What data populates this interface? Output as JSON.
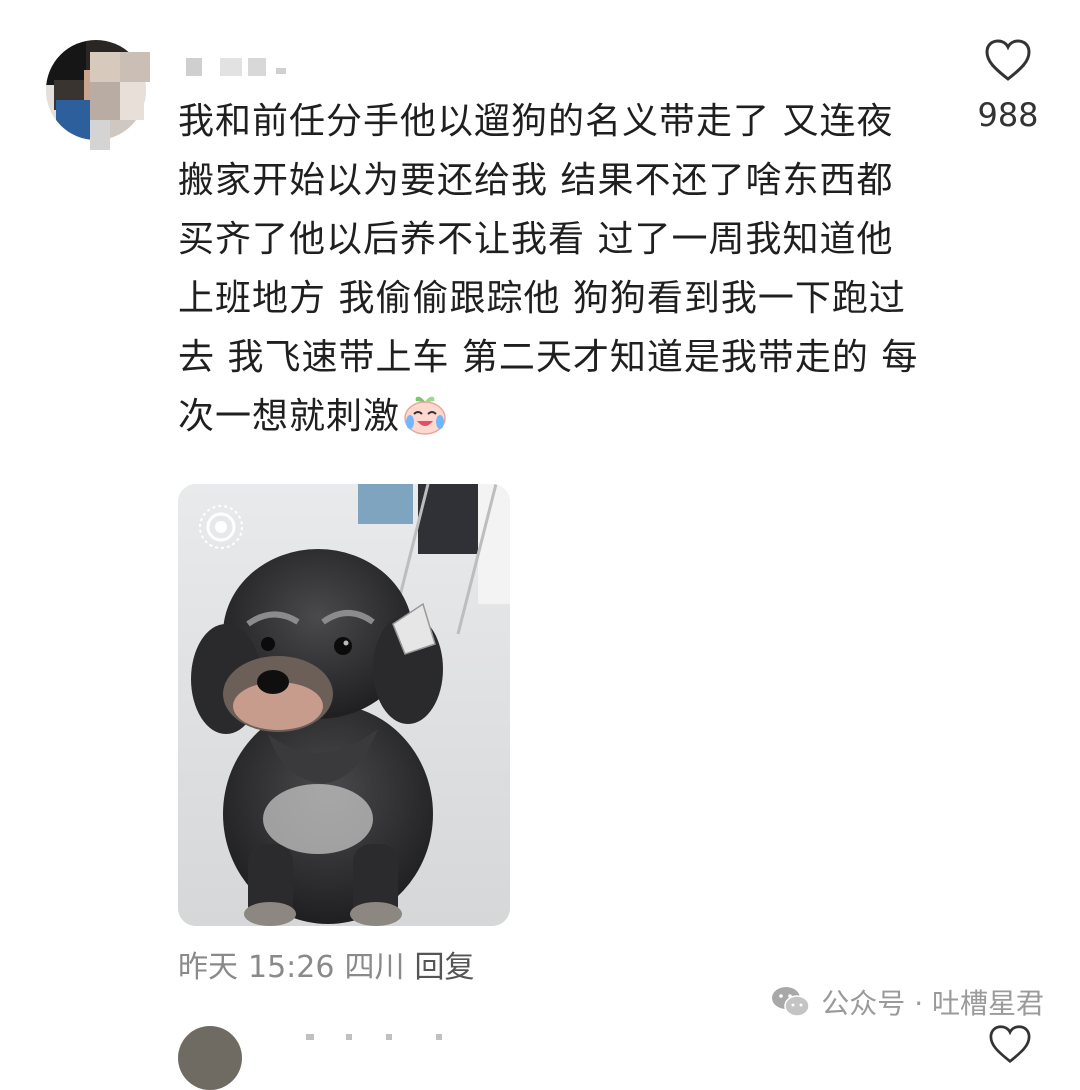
{
  "comment": {
    "username": "",
    "text": "我和前任分手他以遛狗的名义带走了 又连夜搬家开始以为要还给我 结果不还了啥东西都买齐了他以后养不让我看 过了一周我知道他上班地方 我偷偷跟踪他 狗狗看到我一下跑过去 我飞速带上车 第二天才知道是我带走的 每次一想就刺激",
    "emoji": "laughing-crying-peach-face",
    "likes": "988",
    "photo": {
      "subject": "schnauzer-dog",
      "live_badge": "live-photo-icon"
    },
    "meta": {
      "date": "昨天",
      "time": "15:26",
      "location": "四川",
      "reply_label": "回复"
    }
  },
  "watermark": {
    "text": "公众号 · 吐槽星君",
    "icon": "wechat-icon"
  },
  "colors": {
    "text": "#1f1f1f",
    "meta": "#8a8a8a",
    "background": "#ffffff"
  }
}
